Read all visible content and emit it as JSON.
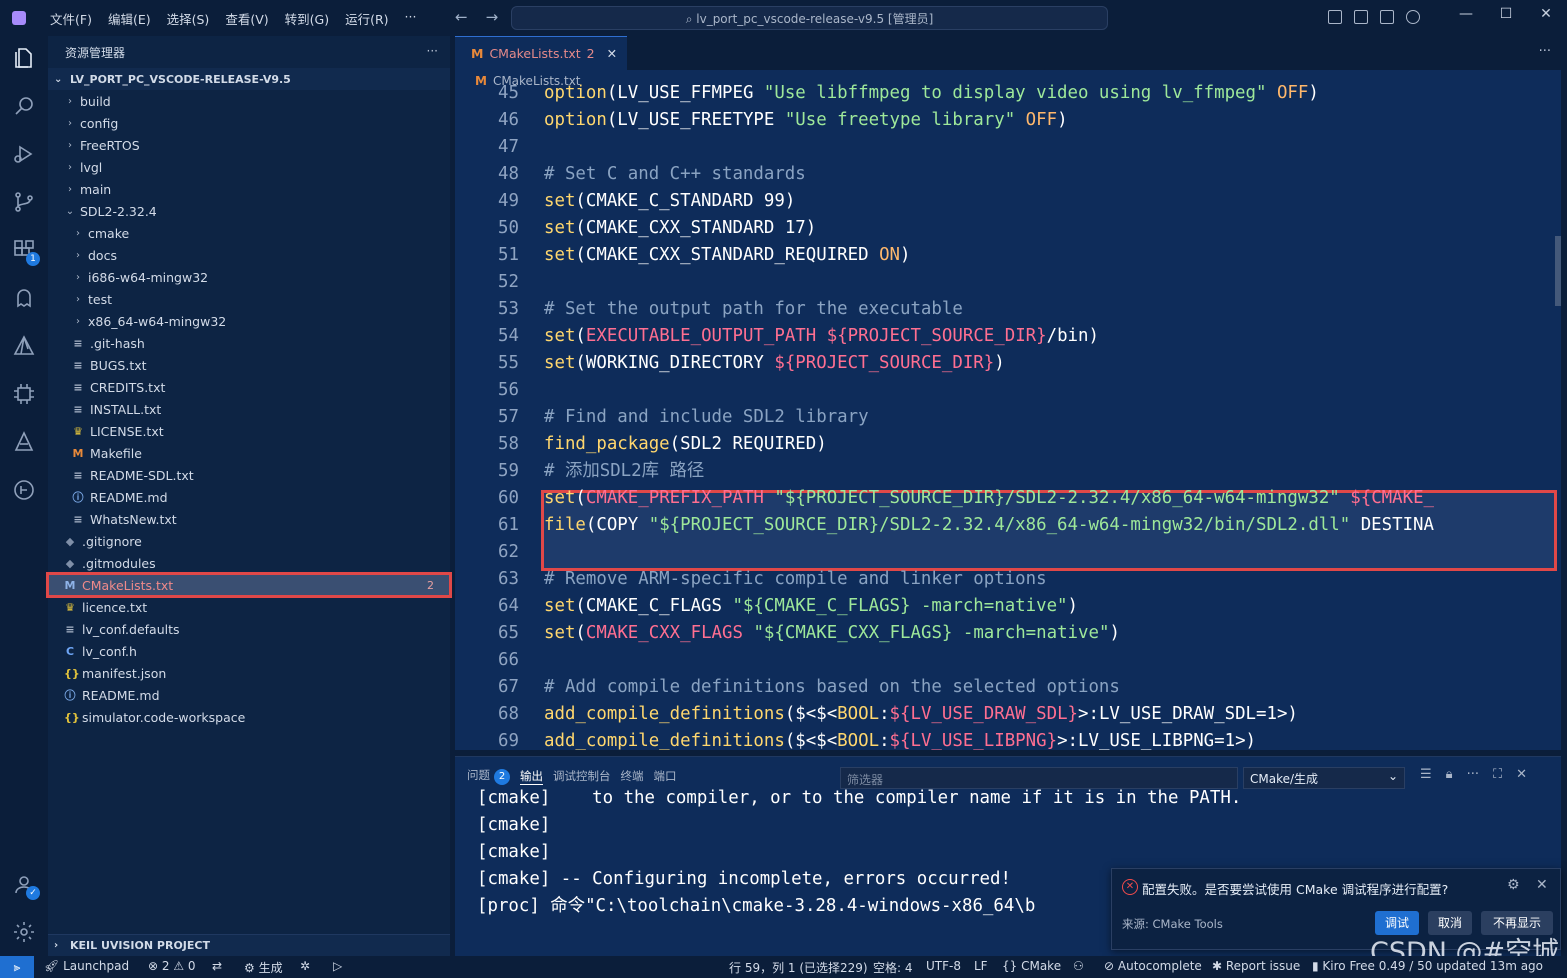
{
  "menu": [
    "文件(F)",
    "编辑(E)",
    "选择(S)",
    "查看(V)",
    "转到(G)",
    "运行(R)",
    "···"
  ],
  "search_box": "⌕ lv_port_pc_vscode-release-v9.5 [管理员]",
  "explorer": {
    "title": "资源管理器",
    "root": "LV_PORT_PC_VSCODE-RELEASE-V9.5",
    "items": [
      {
        "label": "build",
        "depth": 0,
        "icon": "chevron-right"
      },
      {
        "label": "config",
        "depth": 0,
        "icon": "chevron-right"
      },
      {
        "label": "FreeRTOS",
        "depth": 0,
        "icon": "chevron-right"
      },
      {
        "label": "lvgl",
        "depth": 0,
        "icon": "chevron-right"
      },
      {
        "label": "main",
        "depth": 0,
        "icon": "chevron-right"
      },
      {
        "label": "SDL2-2.32.4",
        "depth": 0,
        "icon": "chevron-down"
      },
      {
        "label": "cmake",
        "depth": 1,
        "icon": "chevron-right"
      },
      {
        "label": "docs",
        "depth": 1,
        "icon": "chevron-right"
      },
      {
        "label": "i686-w64-mingw32",
        "depth": 1,
        "icon": "chevron-right"
      },
      {
        "label": "test",
        "depth": 1,
        "icon": "chevron-right"
      },
      {
        "label": "x86_64-w64-mingw32",
        "depth": 1,
        "icon": "chevron-right"
      },
      {
        "label": ".git-hash",
        "depth": 1,
        "icon": "lines"
      },
      {
        "label": "BUGS.txt",
        "depth": 1,
        "icon": "lines"
      },
      {
        "label": "CREDITS.txt",
        "depth": 1,
        "icon": "lines"
      },
      {
        "label": "INSTALL.txt",
        "depth": 1,
        "icon": "lines"
      },
      {
        "label": "LICENSE.txt",
        "depth": 1,
        "icon": "license"
      },
      {
        "label": "Makefile",
        "depth": 1,
        "icon": "m"
      },
      {
        "label": "README-SDL.txt",
        "depth": 1,
        "icon": "lines"
      },
      {
        "label": "README.md",
        "depth": 1,
        "icon": "info"
      },
      {
        "label": "WhatsNew.txt",
        "depth": 1,
        "icon": "lines"
      },
      {
        "label": ".gitignore",
        "depth": 0,
        "icon": "git"
      },
      {
        "label": ".gitmodules",
        "depth": 0,
        "icon": "git"
      },
      {
        "label": "CMakeLists.txt",
        "depth": 0,
        "icon": "m",
        "selected": true,
        "count": "2"
      },
      {
        "label": "licence.txt",
        "depth": 0,
        "icon": "license"
      },
      {
        "label": "lv_conf.defaults",
        "depth": 0,
        "icon": "lines"
      },
      {
        "label": "lv_conf.h",
        "depth": 0,
        "icon": "c"
      },
      {
        "label": "manifest.json",
        "depth": 0,
        "icon": "json"
      },
      {
        "label": "README.md",
        "depth": 0,
        "icon": "info"
      },
      {
        "label": "simulator.code-workspace",
        "depth": 0,
        "icon": "json"
      }
    ],
    "bottom_section": "KEIL UVISION PROJECT"
  },
  "editor": {
    "tab_label": "CMakeLists.txt",
    "tab_count": "2",
    "breadcrumb": "CMakeLists.txt",
    "lines": [
      {
        "n": "45",
        "tokens": [
          [
            "kw",
            "option"
          ],
          [
            "fn",
            "(LV_USE_FFMPEG "
          ],
          [
            "st",
            "\"Use libffmpeg to display video using lv_ffmpeg\""
          ],
          [
            "fn",
            " "
          ],
          [
            "ct",
            "OFF"
          ],
          [
            "fn",
            ")"
          ]
        ]
      },
      {
        "n": "46",
        "tokens": [
          [
            "kw",
            "option"
          ],
          [
            "fn",
            "(LV_USE_FREETYPE "
          ],
          [
            "st",
            "\"Use freetype library\""
          ],
          [
            "fn",
            " "
          ],
          [
            "ct",
            "OFF"
          ],
          [
            "fn",
            ")"
          ]
        ]
      },
      {
        "n": "47",
        "tokens": []
      },
      {
        "n": "48",
        "tokens": [
          [
            "cm",
            "# Set C and C++ standards"
          ]
        ]
      },
      {
        "n": "49",
        "tokens": [
          [
            "kw",
            "set"
          ],
          [
            "fn",
            "(CMAKE_C_STANDARD 99)"
          ]
        ]
      },
      {
        "n": "50",
        "tokens": [
          [
            "kw",
            "set"
          ],
          [
            "fn",
            "(CMAKE_CXX_STANDARD 17)"
          ]
        ]
      },
      {
        "n": "51",
        "tokens": [
          [
            "kw",
            "set"
          ],
          [
            "fn",
            "(CMAKE_CXX_STANDARD_REQUIRED "
          ],
          [
            "ct",
            "ON"
          ],
          [
            "fn",
            ")"
          ]
        ]
      },
      {
        "n": "52",
        "tokens": []
      },
      {
        "n": "53",
        "tokens": [
          [
            "cm",
            "# Set the output path for the executable"
          ]
        ]
      },
      {
        "n": "54",
        "tokens": [
          [
            "kw",
            "set"
          ],
          [
            "fn",
            "("
          ],
          [
            "vr",
            "EXECUTABLE_OUTPUT_PATH"
          ],
          [
            "fn",
            " "
          ],
          [
            "vr",
            "${PROJECT_SOURCE_DIR}"
          ],
          [
            "fn",
            "/bin)"
          ]
        ]
      },
      {
        "n": "55",
        "tokens": [
          [
            "kw",
            "set"
          ],
          [
            "fn",
            "(WORKING_DIRECTORY "
          ],
          [
            "vr",
            "${PROJECT_SOURCE_DIR}"
          ],
          [
            "fn",
            ")"
          ]
        ]
      },
      {
        "n": "56",
        "tokens": []
      },
      {
        "n": "57",
        "tokens": [
          [
            "cm",
            "# Find and include SDL2 library"
          ]
        ]
      },
      {
        "n": "58",
        "tokens": [
          [
            "kw",
            "find_package"
          ],
          [
            "fn",
            "(SDL2 REQUIRED)"
          ]
        ]
      },
      {
        "n": "59",
        "tokens": [
          [
            "cm",
            "# 添加SDL2库 路径"
          ]
        ]
      },
      {
        "n": "60",
        "tokens": [
          [
            "kw",
            "set"
          ],
          [
            "fn",
            "("
          ],
          [
            "vr",
            "CMAKE_PREFIX_PATH"
          ],
          [
            "fn",
            " "
          ],
          [
            "st",
            "\"${PROJECT_SOURCE_DIR}/SDL2-2.32.4/x86_64-w64-mingw32\""
          ],
          [
            "fn",
            " "
          ],
          [
            "vr",
            "${CMAKE_"
          ]
        ]
      },
      {
        "n": "61",
        "tokens": [
          [
            "kw",
            "file"
          ],
          [
            "fn",
            "(COPY "
          ],
          [
            "st",
            "\"${PROJECT_SOURCE_DIR}/SDL2-2.32.4/x86_64-w64-mingw32/bin/SDL2.dll\""
          ],
          [
            "fn",
            " DESTINA"
          ]
        ]
      },
      {
        "n": "62",
        "tokens": []
      },
      {
        "n": "63",
        "tokens": [
          [
            "cm",
            "# Remove ARM-specific compile and linker options"
          ]
        ]
      },
      {
        "n": "64",
        "tokens": [
          [
            "kw",
            "set"
          ],
          [
            "fn",
            "(CMAKE_C_FLAGS "
          ],
          [
            "st",
            "\"${CMAKE_C_FLAGS} -march=native\""
          ],
          [
            "fn",
            ")"
          ]
        ]
      },
      {
        "n": "65",
        "tokens": [
          [
            "kw",
            "set"
          ],
          [
            "fn",
            "("
          ],
          [
            "vr",
            "CMAKE_CXX_FLAGS"
          ],
          [
            "fn",
            " "
          ],
          [
            "st",
            "\"${CMAKE_CXX_FLAGS} -march=native\""
          ],
          [
            "fn",
            ")"
          ]
        ]
      },
      {
        "n": "66",
        "tokens": []
      },
      {
        "n": "67",
        "tokens": [
          [
            "cm",
            "# Add compile definitions based on the selected options"
          ]
        ]
      },
      {
        "n": "68",
        "tokens": [
          [
            "kw",
            "add_compile_definitions"
          ],
          [
            "fn",
            "($<$<"
          ],
          [
            "kw",
            "BOOL"
          ],
          [
            "fn",
            ":"
          ],
          [
            "vr",
            "${LV_USE_DRAW_SDL}"
          ],
          [
            "fn",
            ">:LV_USE_DRAW_SDL=1>)"
          ]
        ]
      },
      {
        "n": "69",
        "tokens": [
          [
            "kw",
            "add_compile_definitions"
          ],
          [
            "fn",
            "($<$<"
          ],
          [
            "kw",
            "BOOL"
          ],
          [
            "fn",
            ":"
          ],
          [
            "vr",
            "${LV_USE_LIBPNG}"
          ],
          [
            "fn",
            ">:LV_USE_LIBPNG=1>)"
          ]
        ]
      }
    ]
  },
  "panel": {
    "tabs": [
      {
        "label": "问题",
        "badge": "2"
      },
      {
        "label": "输出",
        "active": true
      },
      {
        "label": "调试控制台"
      },
      {
        "label": "终端"
      },
      {
        "label": "端口"
      }
    ],
    "filter_placeholder": "筛选器",
    "channel": "CMake/生成",
    "output_lines": [
      "[cmake]    to the compiler, or to the compiler name if it is in the PATH.",
      "[cmake]",
      "[cmake]",
      "[cmake] -- Configuring incomplete, errors occurred!",
      "[proc] 命令\"C:\\toolchain\\cmake-3.28.4-windows-x86_64\\b"
    ]
  },
  "notification": {
    "message": "配置失败。是否要尝试使用 CMake 调试程序进行配置?",
    "source": "来源: CMake Tools",
    "buttons": [
      "调试",
      "取消",
      "不再显示"
    ]
  },
  "watermark": "CSDN @#空城",
  "statusbar": {
    "launchpad": "Launchpad",
    "problems": "⊗ 2 ⚠ 0",
    "build": "⚙ 生成",
    "position": "行 59，列 1 (已选择229)",
    "spaces": "空格: 4",
    "encoding": "UTF-8",
    "eol": "LF",
    "language": "{} CMake",
    "autocomplete": "Autocomplete",
    "report": "Report issue",
    "kiro": "Kiro Free 0.49 / 50 updated 13m ago"
  },
  "colors": {
    "keyword": "#ffd76e",
    "string": "#9ee89a",
    "variable": "#ff6f91",
    "comment": "#8aa3c2",
    "highlight_border": "#e04848",
    "accent": "#1f6fd1"
  }
}
